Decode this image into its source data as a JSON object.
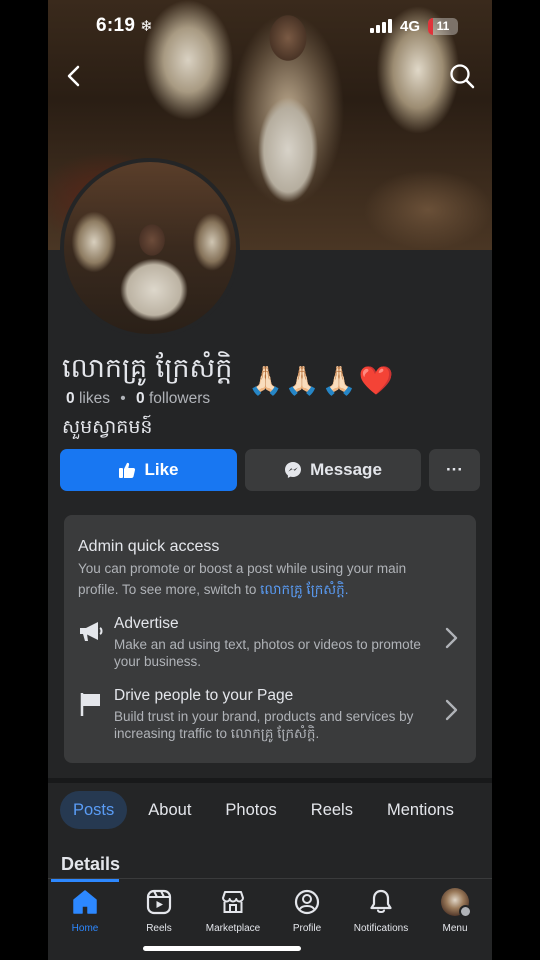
{
  "status_bar": {
    "time": "6:19",
    "network": "4G",
    "battery": "11"
  },
  "page": {
    "name": "លោកគ្រូ ក្រែសំក្តិ",
    "name_emoji": "🙏🏻🙏🏻🙏🏻❤️",
    "likes_count": "0",
    "likes_label": "likes",
    "followers_count": "0",
    "followers_label": "followers",
    "category": "សួមស្វាគមន៍"
  },
  "actions": {
    "like_label": "Like",
    "message_label": "Message",
    "more_label": "···"
  },
  "admin_card": {
    "title": "Admin quick access",
    "desc_prefix": "You can promote or boost a post while using your main profile. To see more, switch to ",
    "desc_link": "លោកគ្រូ ក្រែសំក្តិ.",
    "advertise_title": "Advertise",
    "advertise_sub": "Make an ad using text, photos or videos to promote your business.",
    "drive_title": "Drive people to your Page",
    "drive_sub": "Build trust in your brand, products and services by increasing traffic to លោកគ្រូ ក្រែសំក្តិ."
  },
  "tabs": [
    "Posts",
    "About",
    "Photos",
    "Reels",
    "Mentions"
  ],
  "details_title": "Details",
  "bottom_nav": [
    {
      "label": "Home",
      "icon": "home-icon"
    },
    {
      "label": "Reels",
      "icon": "reels-icon"
    },
    {
      "label": "Marketplace",
      "icon": "marketplace-icon"
    },
    {
      "label": "Profile",
      "icon": "profile-icon"
    },
    {
      "label": "Notifications",
      "icon": "bell-icon"
    },
    {
      "label": "Menu",
      "icon": "menu-avatar"
    }
  ],
  "colors": {
    "accent": "#1877f2",
    "active_nav": "#2d88ff",
    "background": "#242526",
    "card": "#3a3b3c"
  }
}
